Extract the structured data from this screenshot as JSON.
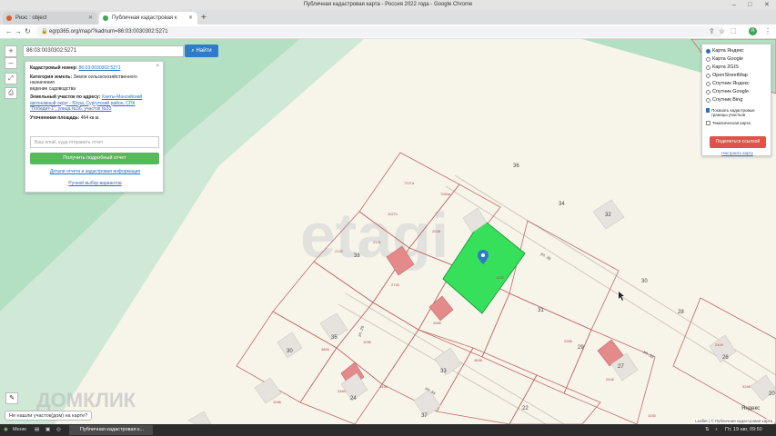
{
  "window": {
    "title": "Публичная кадастровая карта - Россия 2022 года - Google Chrome",
    "minimize": "–",
    "maximize": "□",
    "close": "✕"
  },
  "tabs": [
    {
      "label": "Риэс : object",
      "active": false
    },
    {
      "label": "Публичная кадастровая к",
      "active": true
    }
  ],
  "newtab": "+",
  "address": {
    "url": "egrp365.org/map/?kadnum=86:03:0030302:5271"
  },
  "search": {
    "value": "86:03:0030302:5271",
    "button": "Найти"
  },
  "zoom": {
    "plus": "+",
    "minus": "–"
  },
  "info": {
    "kad_label": "Кадастровый номер:",
    "kad_value": "86:03:0030302:5271",
    "cat_label": "Категория земель:",
    "cat_value": "Земли сельскохозяйственного назначения",
    "use_value": "ведение садоводства",
    "addr_label": "Земельный участок по адресу:",
    "addr_value": "Ханты-Мансийский автономный округ - Югра, Сургутский район, СПК \"Победит-1\", улица №36, участок №33",
    "area_label": "Уточненная площадь:",
    "area_value": "464 кв.м.",
    "email_placeholder": "Ваш email, куда отправить отчет",
    "report_button": "Получить подробный отчет",
    "link1": "Детали отчета и кадастровая информация",
    "link2": "Ручной выбор вариантов",
    "close": "×"
  },
  "layers": {
    "options": [
      "Карта Яндекс",
      "Карта Google",
      "Карта 2GIS",
      "OpenStreetMap",
      "Спутник Яндекс",
      "Спутник Google",
      "Спутник Bing"
    ],
    "selected": 0,
    "check1": "Показать кадастровые границы участков",
    "check2": "Тематическая карта",
    "share": "Поделиться ссылкой",
    "configure": "Настроить карту"
  },
  "tip": "Не нашли участок(дом) на карте?",
  "attribution": "Leaflet | © Публичная кадастровая карта",
  "watermark": "etagi",
  "watermark2": "ДОМКЛИК",
  "taskbar": {
    "menu": "Меню",
    "app": "Публичная кадастровая к...",
    "clock": "Пт, 19 авг, 09:50"
  },
  "map_labels": {
    "plots": [
      "36",
      "34",
      "32",
      "38",
      "30",
      "28",
      "31",
      "29",
      "27",
      "35",
      "33",
      "37",
      "26",
      "24",
      "22",
      "20",
      "30"
    ],
    "cad": [
      "7227а",
      "7060а",
      "1027з",
      "2132",
      "2131",
      "2730",
      "4989",
      "4638",
      "2286",
      "2446",
      "1286",
      "2484",
      "3494",
      "4808",
      "2409",
      "1030",
      "3246",
      "2028",
      "1032",
      "1036"
    ],
    "streets": [
      "ул. 36",
      "ул. 35",
      "ул. 34",
      "ул. 26"
    ],
    "yandex": "Яндекс"
  },
  "colors": {
    "selected_plot": "#36e05a",
    "boundary": "#c26a6a",
    "building": "#e48a8a",
    "forest": "#b3dfc3"
  }
}
